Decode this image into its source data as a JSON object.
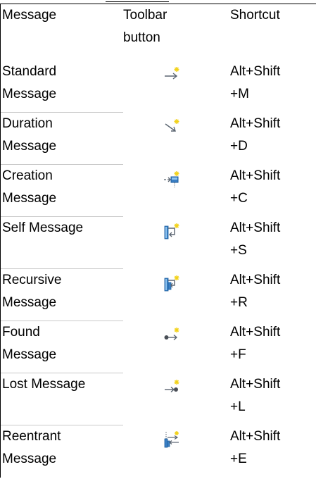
{
  "table": {
    "headers": {
      "message": "Message",
      "toolbar_button": [
        "Toolbar",
        "button"
      ],
      "shortcut": "Shortcut"
    },
    "rows": [
      {
        "message": [
          "Standard",
          "Message"
        ],
        "icon": "standard-message-icon",
        "shortcut": [
          "Alt+Shift",
          "+M"
        ]
      },
      {
        "message": [
          "Duration",
          "Message"
        ],
        "icon": "duration-message-icon",
        "shortcut": [
          "Alt+Shift",
          "+D"
        ]
      },
      {
        "message": [
          "Creation",
          "Message"
        ],
        "icon": "creation-message-icon",
        "shortcut": [
          "Alt+Shift",
          "+C"
        ]
      },
      {
        "message": [
          "Self Message",
          ""
        ],
        "icon": "self-message-icon",
        "shortcut": [
          "Alt+Shift",
          "+S"
        ]
      },
      {
        "message": [
          "Recursive",
          "Message"
        ],
        "icon": "recursive-message-icon",
        "shortcut": [
          "Alt+Shift",
          "+R"
        ]
      },
      {
        "message": [
          "Found",
          "Message"
        ],
        "icon": "found-message-icon",
        "shortcut": [
          "Alt+Shift",
          "+F"
        ]
      },
      {
        "message": [
          "Lost Message",
          ""
        ],
        "icon": "lost-message-icon",
        "shortcut": [
          "Alt+Shift",
          "+L"
        ]
      },
      {
        "message": [
          "Reentrant",
          "Message"
        ],
        "icon": "reentrant-message-icon",
        "shortcut": [
          "Alt+Shift",
          "+E"
        ]
      }
    ]
  },
  "colors": {
    "sparkle": "#f2d21a",
    "arrow": "#5a6470",
    "lifeline": "#3a7fc4",
    "lifeline_light": "#8fc3ef"
  }
}
